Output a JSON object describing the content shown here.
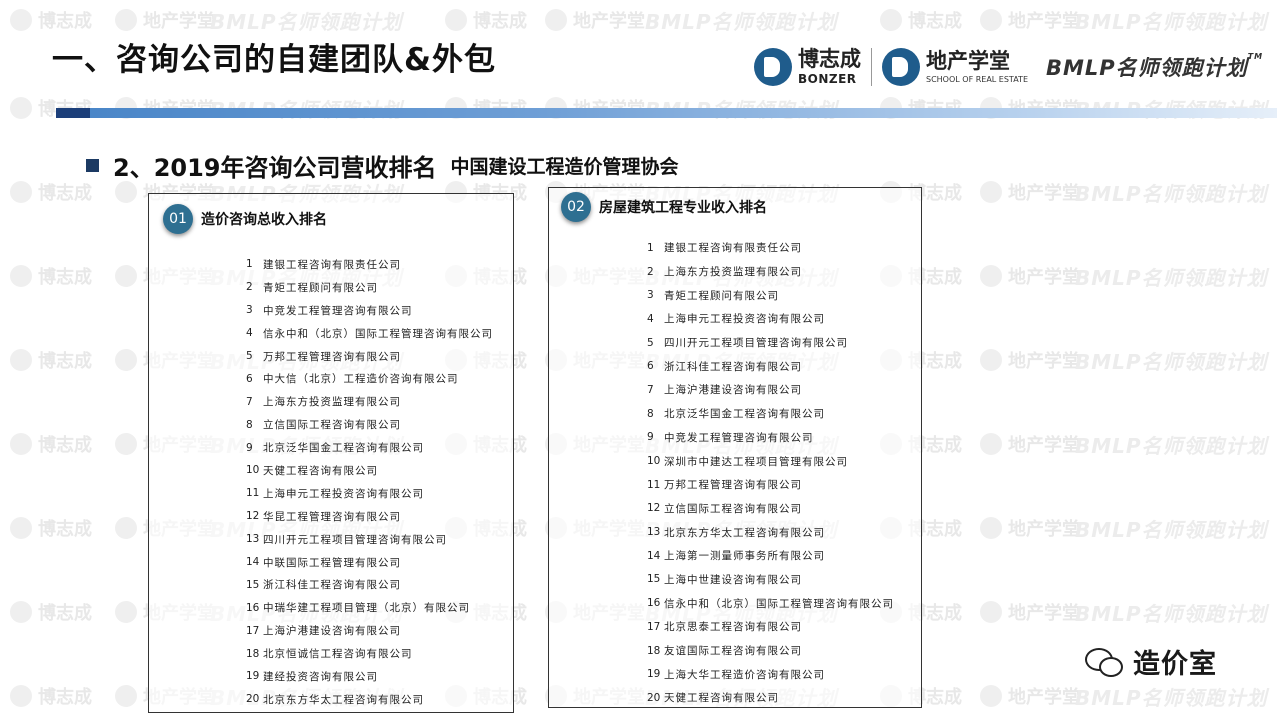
{
  "title": "一、咨询公司的自建团队&外包",
  "brand": {
    "bonzer_cn": "博志成",
    "bonzer_en": "BONZER",
    "school_cn": "地产学堂",
    "school_en": "SCHOOL OF REAL ESTATE",
    "bmlp": "BMLP名师领跑计划",
    "tm": "TM"
  },
  "subheading": {
    "main": "2、2019年咨询公司营收排名",
    "note": "中国建设工程造价管理协会"
  },
  "panels": [
    {
      "badge": "01",
      "title": "造价咨询总收入排名",
      "items": [
        {
          "rank": "1",
          "name": "建银工程咨询有限责任公司"
        },
        {
          "rank": "2",
          "name": "青矩工程顾问有限公司"
        },
        {
          "rank": "3",
          "name": "中竞发工程管理咨询有限公司"
        },
        {
          "rank": "4",
          "name": "信永中和（北京）国际工程管理咨询有限公司"
        },
        {
          "rank": "5",
          "name": "万邦工程管理咨询有限公司"
        },
        {
          "rank": "6",
          "name": "中大信（北京）工程造价咨询有限公司"
        },
        {
          "rank": "7",
          "name": "上海东方投资监理有限公司"
        },
        {
          "rank": "8",
          "name": "立信国际工程咨询有限公司"
        },
        {
          "rank": "9",
          "name": "北京泛华国金工程咨询有限公司"
        },
        {
          "rank": "10",
          "name": "天健工程咨询有限公司"
        },
        {
          "rank": "11",
          "name": "上海申元工程投资咨询有限公司"
        },
        {
          "rank": "12",
          "name": "华昆工程管理咨询有限公司"
        },
        {
          "rank": "13",
          "name": "四川开元工程项目管理咨询有限公司"
        },
        {
          "rank": "14",
          "name": "中联国际工程管理有限公司"
        },
        {
          "rank": "15",
          "name": "浙江科佳工程咨询有限公司"
        },
        {
          "rank": "16",
          "name": "中瑞华建工程项目管理（北京）有限公司"
        },
        {
          "rank": "17",
          "name": "上海沪港建设咨询有限公司"
        },
        {
          "rank": "18",
          "name": "北京恒诚信工程咨询有限公司"
        },
        {
          "rank": "19",
          "name": "建经投资咨询有限公司"
        },
        {
          "rank": "20",
          "name": "北京东方华太工程咨询有限公司"
        }
      ]
    },
    {
      "badge": "02",
      "title": "房屋建筑工程专业收入排名",
      "items": [
        {
          "rank": "1",
          "name": "建银工程咨询有限责任公司"
        },
        {
          "rank": "2",
          "name": "上海东方投资监理有限公司"
        },
        {
          "rank": "3",
          "name": "青矩工程顾问有限公司"
        },
        {
          "rank": "4",
          "name": "上海申元工程投资咨询有限公司"
        },
        {
          "rank": "5",
          "name": "四川开元工程项目管理咨询有限公司"
        },
        {
          "rank": "6",
          "name": "浙江科佳工程咨询有限公司"
        },
        {
          "rank": "7",
          "name": "上海沪港建设咨询有限公司"
        },
        {
          "rank": "8",
          "name": "北京泛华国金工程咨询有限公司"
        },
        {
          "rank": "9",
          "name": "中竞发工程管理咨询有限公司"
        },
        {
          "rank": "10",
          "name": "深圳市中建达工程项目管理有限公司"
        },
        {
          "rank": "11",
          "name": "万邦工程管理咨询有限公司"
        },
        {
          "rank": "12",
          "name": "立信国际工程咨询有限公司"
        },
        {
          "rank": "13",
          "name": "北京东方华太工程咨询有限公司"
        },
        {
          "rank": "14",
          "name": "上海第一测量师事务所有限公司"
        },
        {
          "rank": "15",
          "name": "上海中世建设咨询有限公司"
        },
        {
          "rank": "16",
          "name": "信永中和（北京）国际工程管理咨询有限公司"
        },
        {
          "rank": "17",
          "name": "北京思泰工程咨询有限公司"
        },
        {
          "rank": "18",
          "name": "友谊国际工程咨询有限公司"
        },
        {
          "rank": "19",
          "name": "上海大华工程造价咨询有限公司"
        },
        {
          "rank": "20",
          "name": "天健工程咨询有限公司"
        }
      ]
    }
  ],
  "wechat": {
    "icon": "wechat-icon",
    "label": "造价室"
  },
  "colors": {
    "accent_dark": "#1c3a63",
    "bar": "#4a86c8",
    "badge": "#2e6f91"
  }
}
